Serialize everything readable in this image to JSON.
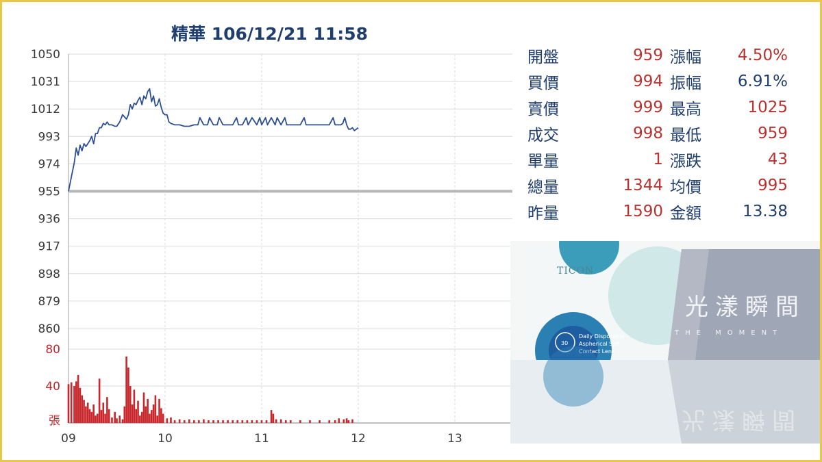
{
  "title": "精華 106/12/21 11:58",
  "chart_data": {
    "type": "line",
    "title": "精華 106/12/21 11:58",
    "price_axis": {
      "ylim": [
        860,
        1050
      ],
      "ticks": [
        "1050",
        "1031",
        "1012",
        "993",
        "974",
        "955",
        "936",
        "917",
        "898",
        "879",
        "860"
      ]
    },
    "volume_axis": {
      "ylim": [
        0,
        80
      ],
      "ticks": [
        "80",
        "40"
      ],
      "unit": "張"
    },
    "x_axis": {
      "ticks": [
        "09",
        "10",
        "11",
        "12",
        "13"
      ],
      "range_hours": [
        9,
        13
      ]
    },
    "reference_price": 955,
    "grid": true,
    "colors": {
      "price_line": "#2c4f93",
      "reference_line": "#b7b7b7",
      "volume_bar": "#c9272c",
      "grid": "#d9d9d9"
    },
    "series": [
      {
        "type": "line",
        "x": [
          9.0,
          9.03,
          9.06,
          9.08,
          9.1,
          9.12,
          9.14,
          9.16,
          9.18,
          9.2,
          9.22,
          9.24,
          9.26,
          9.28,
          9.3,
          9.32,
          9.34,
          9.36,
          9.38,
          9.4,
          9.42,
          9.45,
          9.48,
          9.5,
          9.53,
          9.56,
          9.6,
          9.62,
          9.64,
          9.66,
          9.68,
          9.7,
          9.72,
          9.74,
          9.76,
          9.78,
          9.8,
          9.82,
          9.84,
          9.86,
          9.88,
          9.9,
          9.92,
          9.94,
          9.96,
          9.98,
          10.0,
          10.02,
          10.04,
          10.06,
          10.1,
          10.15,
          10.2,
          10.25,
          10.3,
          10.34,
          10.36,
          10.4,
          10.44,
          10.46,
          10.5,
          10.54,
          10.56,
          10.6,
          10.65,
          10.7,
          10.74,
          10.76,
          10.8,
          10.84,
          10.86,
          10.9,
          10.95,
          10.98,
          11.0,
          11.04,
          11.06,
          11.1,
          11.14,
          11.16,
          11.2,
          11.24,
          11.26,
          11.3,
          11.35,
          11.4,
          11.44,
          11.46,
          11.5,
          11.55,
          11.6,
          11.65,
          11.7,
          11.74,
          11.76,
          11.8,
          11.82,
          11.84,
          11.86,
          11.88,
          11.9,
          11.92,
          11.94,
          11.96,
          11.98,
          12.0
        ],
        "values": [
          955,
          965,
          975,
          985,
          980,
          987,
          983,
          988,
          986,
          988,
          990,
          993,
          988,
          995,
          995,
          999,
          999,
          1002,
          1001,
          1003,
          1001,
          1001,
          1000,
          1000,
          1003,
          1008,
          1005,
          1008,
          1015,
          1012,
          1016,
          1015,
          1018,
          1020,
          1015,
          1021,
          1019,
          1024,
          1026,
          1017,
          1021,
          1014,
          1015,
          1019,
          1013,
          1009,
          1008,
          1008,
          1003,
          1002,
          1001,
          1001,
          1000,
          1000,
          1001,
          1001,
          1006,
          1001,
          1001,
          1006,
          1001,
          1001,
          1006,
          1001,
          1001,
          1001,
          1006,
          1001,
          1001,
          1006,
          1001,
          1006,
          1001,
          1006,
          1001,
          1006,
          1001,
          1006,
          1001,
          1006,
          1001,
          1006,
          1001,
          1001,
          1001,
          1001,
          1006,
          1001,
          1001,
          1001,
          1001,
          1001,
          1001,
          1006,
          1001,
          1001,
          1001,
          1002,
          1006,
          1001,
          998,
          998,
          999,
          997,
          998,
          999
        ]
      },
      {
        "type": "bar",
        "x": [
          9.0,
          9.03,
          9.06,
          9.08,
          9.1,
          9.12,
          9.14,
          9.16,
          9.18,
          9.2,
          9.22,
          9.24,
          9.26,
          9.28,
          9.3,
          9.32,
          9.34,
          9.36,
          9.38,
          9.4,
          9.42,
          9.45,
          9.48,
          9.5,
          9.53,
          9.56,
          9.58,
          9.6,
          9.62,
          9.64,
          9.66,
          9.68,
          9.7,
          9.72,
          9.74,
          9.76,
          9.78,
          9.8,
          9.82,
          9.84,
          9.86,
          9.88,
          9.9,
          9.92,
          9.94,
          9.96,
          9.98,
          10.02,
          10.06,
          10.1,
          10.15,
          10.2,
          10.25,
          10.3,
          10.35,
          10.4,
          10.45,
          10.5,
          10.55,
          10.6,
          10.65,
          10.7,
          10.75,
          10.8,
          10.85,
          10.9,
          10.95,
          11.0,
          11.05,
          11.1,
          11.12,
          11.15,
          11.2,
          11.25,
          11.3,
          11.4,
          11.5,
          11.6,
          11.7,
          11.76,
          11.8,
          11.85,
          11.88,
          11.9,
          11.94
        ],
        "values": [
          42,
          44,
          40,
          45,
          52,
          38,
          30,
          25,
          18,
          22,
          15,
          12,
          20,
          8,
          10,
          48,
          14,
          22,
          10,
          28,
          15,
          6,
          12,
          5,
          8,
          4,
          18,
          72,
          60,
          40,
          20,
          36,
          15,
          24,
          8,
          12,
          33,
          18,
          26,
          10,
          14,
          20,
          30,
          8,
          26,
          16,
          10,
          5,
          6,
          3,
          4,
          3,
          4,
          3,
          3,
          4,
          3,
          3,
          3,
          3,
          3,
          3,
          3,
          3,
          3,
          3,
          3,
          3,
          3,
          14,
          10,
          4,
          4,
          3,
          3,
          3,
          3,
          3,
          3,
          3,
          5,
          4,
          5,
          3,
          4
        ]
      }
    ]
  },
  "quote": {
    "rows": [
      {
        "l1": "開盤",
        "v1": "959",
        "l2": "漲幅",
        "v2": "4.50%"
      },
      {
        "l1": "買價",
        "v1": "994",
        "l2": "振幅",
        "v2": "6.91%"
      },
      {
        "l1": "賣價",
        "v1": "999",
        "l2": "最高",
        "v2": "1025"
      },
      {
        "l1": "成交",
        "v1": "998",
        "l2": "最低",
        "v2": "959"
      },
      {
        "l1": "單量",
        "v1": "1",
        "l2": "漲跌",
        "v2": "43"
      },
      {
        "l1": "總量",
        "v1": "1344",
        "l2": "均價",
        "v2": "995"
      },
      {
        "l1": "昨量",
        "v1": "1590",
        "l2": "金額",
        "v2": "13.38"
      }
    ]
  },
  "product": {
    "logo": "TICON",
    "brand_cn": "光漾瞬間",
    "brand_en": "THE MOMENT",
    "badge_num": "30",
    "badge_desc": [
      "Daily Disposable",
      "Aspherical Soft",
      "Contact Lens"
    ]
  }
}
